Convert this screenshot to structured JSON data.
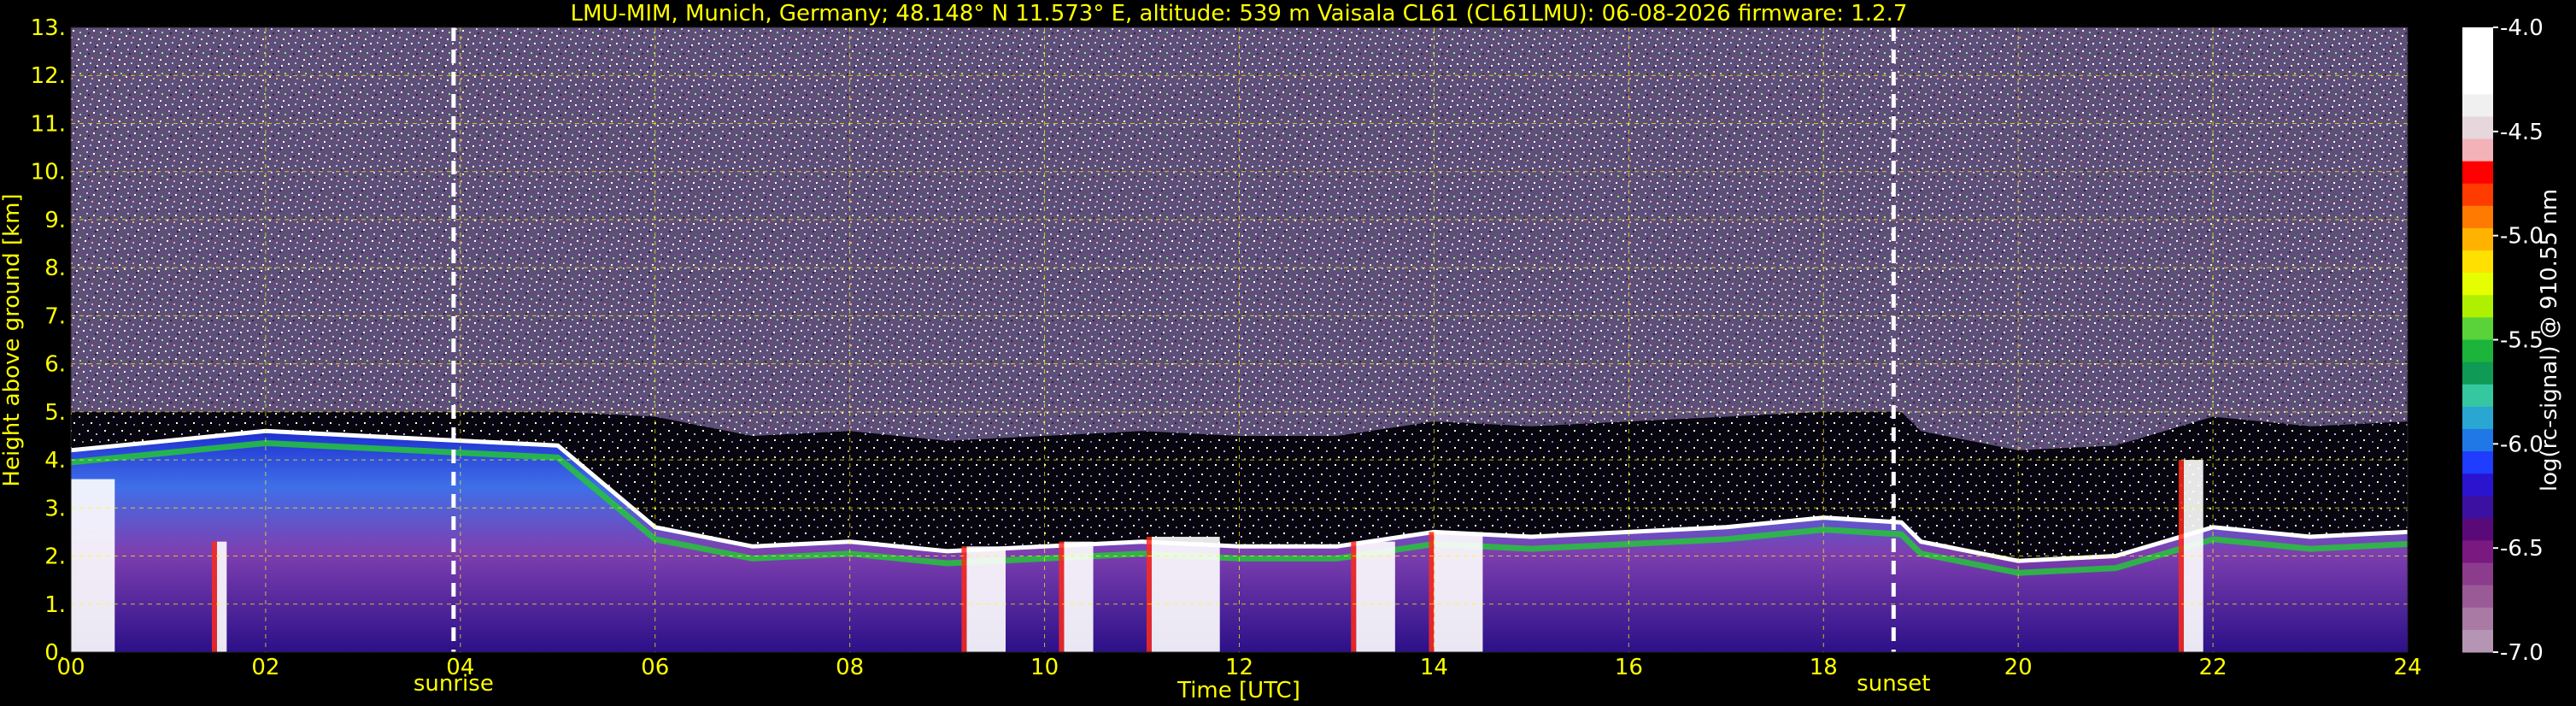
{
  "chart_data": {
    "type": "heatmap",
    "title": "LMU-MIM, Munich, Germany; 48.148° N 11.573° E, altitude: 539 m    Vaisala CL61 (CL61LMU): 06-08-2026    firmware: 1.2.7",
    "xlabel": "Time [UTC]",
    "ylabel": "Height above ground [km]",
    "colorbar_label": "log(rc-signal) @ 910.55 nm",
    "xlim": [
      0,
      24
    ],
    "ylim": [
      0,
      13
    ],
    "x_ticks": [
      "00",
      "02",
      "04",
      "06",
      "08",
      "10",
      "12",
      "14",
      "16",
      "18",
      "20",
      "22",
      "24"
    ],
    "y_ticks": [
      "0.",
      "1.",
      "2.",
      "3.",
      "4.",
      "5.",
      "6.",
      "7.",
      "8.",
      "9.",
      "10.",
      "11.",
      "12.",
      "13."
    ],
    "colorbar_range": [
      -7.0,
      -4.0
    ],
    "colorbar_ticks": [
      "-4.0",
      "-4.5",
      "-5.0",
      "-5.5",
      "-6.0",
      "-6.5",
      "-7.0"
    ],
    "grid": true,
    "annotations": [
      {
        "text": "sunrise",
        "x": 3.93
      },
      {
        "text": "sunset",
        "x": 18.72
      }
    ],
    "boundary_layer_top_km": [
      [
        0,
        4.2
      ],
      [
        1,
        4.4
      ],
      [
        2,
        4.6
      ],
      [
        3,
        4.5
      ],
      [
        4,
        4.4
      ],
      [
        5,
        4.3
      ],
      [
        6,
        2.6
      ],
      [
        7,
        2.2
      ],
      [
        8,
        2.3
      ],
      [
        9,
        2.1
      ],
      [
        10,
        2.2
      ],
      [
        11,
        2.3
      ],
      [
        12,
        2.2
      ],
      [
        13,
        2.2
      ],
      [
        14,
        2.5
      ],
      [
        15,
        2.4
      ],
      [
        16,
        2.5
      ],
      [
        17,
        2.6
      ],
      [
        18,
        2.8
      ],
      [
        18.8,
        2.7
      ],
      [
        19,
        2.3
      ],
      [
        20,
        1.9
      ],
      [
        21,
        2.0
      ],
      [
        22,
        2.6
      ],
      [
        23,
        2.4
      ],
      [
        24,
        2.5
      ]
    ]
  }
}
